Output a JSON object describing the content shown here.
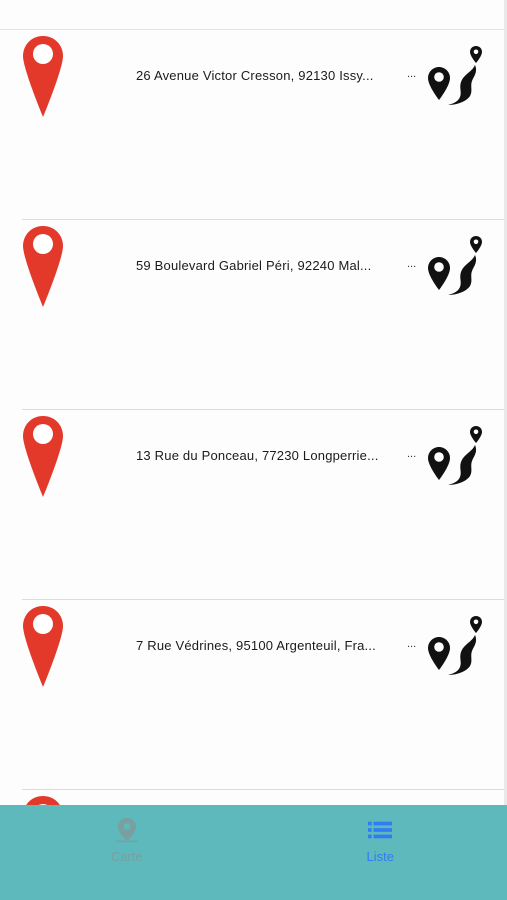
{
  "list": {
    "items": [
      {
        "address": "26 Avenue Victor Cresson, 92130 Issy...",
        "more": "..."
      },
      {
        "address": "59 Boulevard Gabriel Péri, 92240 Mal...",
        "more": "..."
      },
      {
        "address": "13 Rue du Ponceau, 77230 Longperrie...",
        "more": "..."
      },
      {
        "address": "7 Rue Védrines, 95100 Argenteuil, Fra...",
        "more": "..."
      }
    ],
    "pin_color": "#e2392b",
    "pin_icon": "location-pin-icon",
    "route_icon": "route-icon"
  },
  "tabbar": {
    "background": "#5db9bb",
    "tabs": [
      {
        "label": "Carte",
        "icon": "map-marker-icon",
        "active": false
      },
      {
        "label": "Liste",
        "icon": "list-icon",
        "active": true
      }
    ],
    "active_color": "#2f7cf6",
    "inactive_color": "#7a9fa0"
  }
}
